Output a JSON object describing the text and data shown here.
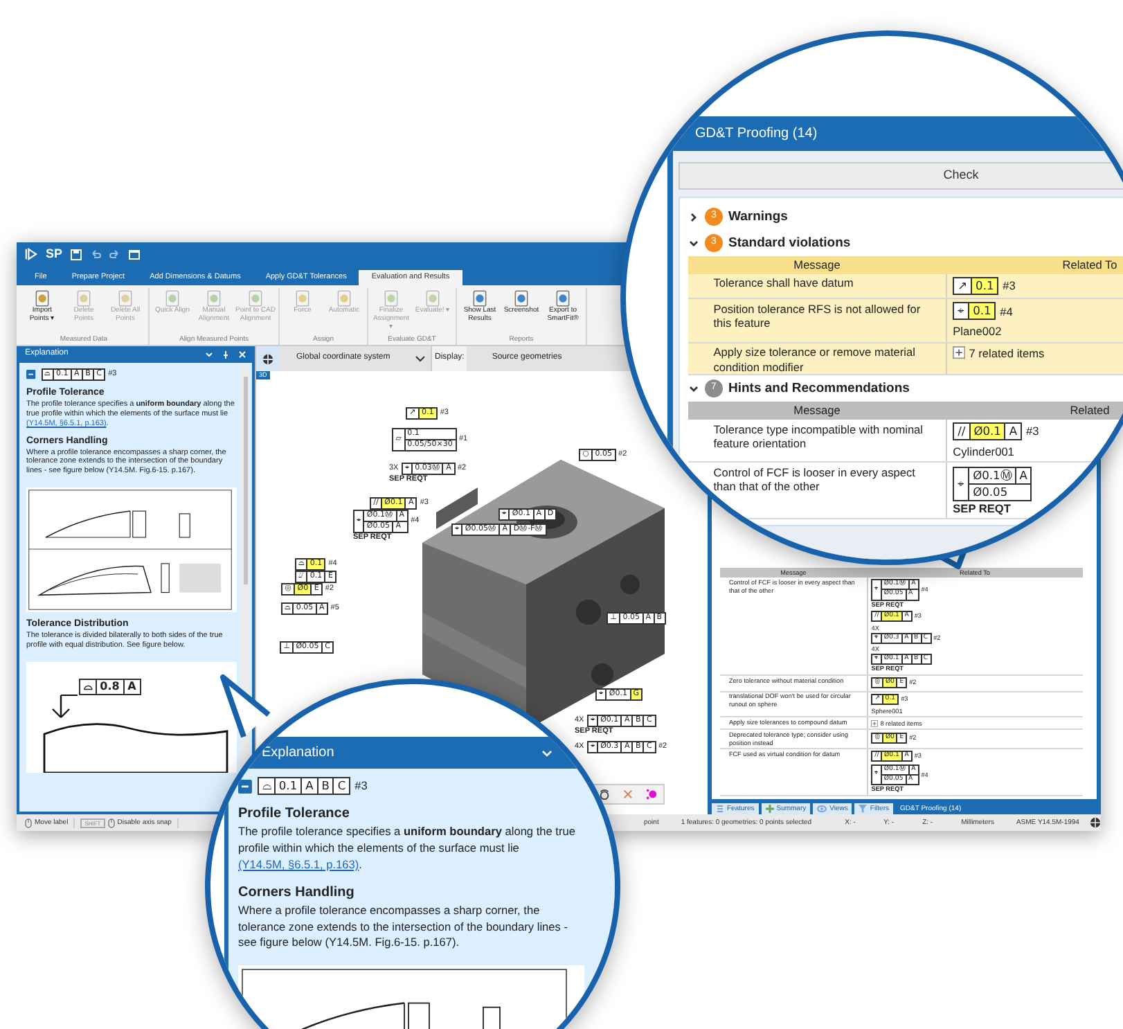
{
  "app": {
    "logo": "SP",
    "ribbon_tabs": [
      {
        "label": "File",
        "selected": false
      },
      {
        "label": "Prepare Project",
        "selected": false
      },
      {
        "label": "Add Dimensions & Datums",
        "selected": false
      },
      {
        "label": "Apply GD&T Tolerances",
        "selected": false
      },
      {
        "label": "Evaluation and Results",
        "selected": true
      }
    ],
    "ribbon_groups": [
      {
        "label": "Measured Data",
        "buttons": [
          {
            "label": "Import Points ▾",
            "disabled": false
          },
          {
            "label": "Delete Points",
            "disabled": true
          },
          {
            "label": "Delete All Points",
            "disabled": true
          }
        ]
      },
      {
        "label": "Align Measured Points",
        "buttons": [
          {
            "label": "Quick Align",
            "disabled": true
          },
          {
            "label": "Manual Alignment",
            "disabled": true
          },
          {
            "label": "Point to CAD Alignment",
            "disabled": true
          }
        ]
      },
      {
        "label": "Assign",
        "buttons": [
          {
            "label": "Force",
            "disabled": true
          },
          {
            "label": "Automatic",
            "disabled": true
          }
        ]
      },
      {
        "label": "Evaluate GD&T",
        "buttons": [
          {
            "label": "Finalize Assignment ▾",
            "disabled": true
          },
          {
            "label": "Evaluate! ▾",
            "disabled": true
          }
        ]
      },
      {
        "label": "Reports",
        "buttons": [
          {
            "label": "Show Last Results",
            "disabled": false
          },
          {
            "label": "Screenshot",
            "disabled": false
          },
          {
            "label": "Export to SmartFit®",
            "disabled": false
          }
        ]
      }
    ],
    "explanation": {
      "title": "Explanation",
      "fcf": {
        "kind": "fcf",
        "cells": [
          {
            "text": "⌓",
            "highlighted": false
          },
          {
            "text": "0.1",
            "highlighted": false
          },
          {
            "text": "A",
            "highlighted": false
          },
          {
            "text": "B",
            "highlighted": false
          },
          {
            "text": "C",
            "highlighted": false
          }
        ],
        "tag": "#3"
      },
      "sections": [
        {
          "heading": "Profile Tolerance",
          "text": "The profile tolerance specifies a **uniform boundary** along the true profile within which the elements of the surface must lie",
          "link": "(Y14.5M, §6.5.1, p.163)",
          "link_suffix": "."
        },
        {
          "heading": "Corners Handling",
          "text": "Where a profile tolerance encompasses a sharp corner, the tolerance zone extends to the intersection of the boundary lines - see figure below (Y14.5M. Fig.6-15. p.167)."
        },
        {
          "heading": "Tolerance Distribution",
          "text": "The tolerance is divided bilaterally to both sides of the true profile with equal distribution. See figure below.",
          "figure": {
            "kind": "profile_diagram",
            "fcf": {
              "kind": "fcf",
              "cells": [
                {
                  "text": "⌓",
                  "highlighted": false
                },
                {
                  "text": "0.8",
                  "highlighted": false
                },
                {
                  "text": "A",
                  "highlighted": false
                }
              ]
            }
          }
        }
      ]
    },
    "viewport": {
      "coordinate_system": "Global coordinate system",
      "display_label": "Display:",
      "display_value": "Source geometries",
      "view_tab": "3D",
      "annotations": [
        {
          "kind": "fcf",
          "cells": [
            {
              "text": "↗",
              "highlighted": false
            },
            {
              "text": "0.1",
              "highlighted": true
            }
          ],
          "tag": "#3"
        },
        {
          "kind": "composite",
          "symbol": {
            "text": "▱",
            "highlighted": false
          },
          "rows": [
            {
              "cells": [
                {
                  "text": "0.1",
                  "highlighted": false
                }
              ]
            },
            {
              "cells": [
                {
                  "text": "0.05/50×30",
                  "highlighted": false
                }
              ]
            }
          ],
          "tag": "#1"
        },
        {
          "kind": "fcf",
          "cells": [
            {
              "text": "○",
              "highlighted": false
            },
            {
              "text": "0.05",
              "highlighted": false
            }
          ],
          "tag": "#2"
        },
        {
          "kind": "fcf",
          "prefix": "3X",
          "cells": [
            {
              "text": "⌖",
              "highlighted": false
            },
            {
              "text": "0.03Ⓜ",
              "highlighted": false
            },
            {
              "text": "A",
              "highlighted": false
            }
          ],
          "tag": "#2",
          "note": "SEP REQT"
        },
        {
          "kind": "fcf",
          "cells": [
            {
              "text": "//",
              "highlighted": false
            },
            {
              "text": "Ø0.1",
              "highlighted": true
            },
            {
              "text": "A",
              "highlighted": false
            }
          ],
          "tag": "#3"
        },
        {
          "kind": "composite",
          "symbol": {
            "text": "⌖",
            "highlighted": false
          },
          "rows": [
            {
              "cells": [
                {
                  "text": "Ø0.1Ⓜ",
                  "highlighted": false
                },
                {
                  "text": "A",
                  "highlighted": false
                }
              ]
            },
            {
              "cells": [
                {
                  "text": "Ø0.05",
                  "highlighted": false
                },
                {
                  "text": "A",
                  "highlighted": false
                }
              ]
            }
          ],
          "tag": "#4",
          "note": "SEP REQT"
        },
        {
          "kind": "fcf",
          "cells": [
            {
              "text": "⌖",
              "highlighted": false
            },
            {
              "text": "Ø0.1",
              "highlighted": false
            },
            {
              "text": "A",
              "highlighted": false
            },
            {
              "text": "D",
              "highlighted": false
            }
          ]
        },
        {
          "kind": "fcf",
          "cells": [
            {
              "text": "⌖",
              "highlighted": false
            },
            {
              "text": "Ø0.05Ⓜ",
              "highlighted": false
            },
            {
              "text": "A",
              "highlighted": false
            },
            {
              "text": "DⓂ-FⓂ",
              "highlighted": false
            }
          ]
        },
        {
          "kind": "fcf",
          "cells": [
            {
              "text": "⌓",
              "highlighted": false
            },
            {
              "text": "0.1",
              "highlighted": true
            }
          ],
          "tag": "#4"
        },
        {
          "kind": "fcf",
          "cells": [
            {
              "text": "⌰",
              "highlighted": false
            },
            {
              "text": "0.1",
              "highlighted": false
            },
            {
              "text": "E",
              "highlighted": false
            }
          ]
        },
        {
          "kind": "fcf",
          "cells": [
            {
              "text": "◎",
              "highlighted": false
            },
            {
              "text": "Ø0",
              "highlighted": true
            },
            {
              "text": "E",
              "highlighted": false
            }
          ],
          "tag": "#2"
        },
        {
          "kind": "fcf",
          "cells": [
            {
              "text": "⌓",
              "highlighted": false
            },
            {
              "text": "0.05",
              "highlighted": false
            },
            {
              "text": "A",
              "highlighted": false
            }
          ],
          "tag": "#5"
        },
        {
          "kind": "fcf",
          "cells": [
            {
              "text": "⊥",
              "highlighted": false
            },
            {
              "text": "Ø0.05",
              "highlighted": false
            },
            {
              "text": "C",
              "highlighted": false
            }
          ]
        },
        {
          "kind": "fcf",
          "cells": [
            {
              "text": "⊥",
              "highlighted": false
            },
            {
              "text": "0.05",
              "highlighted": false
            },
            {
              "text": "A",
              "highlighted": false
            },
            {
              "text": "B",
              "highlighted": false
            }
          ]
        },
        {
          "kind": "fcf",
          "cells": [
            {
              "text": "⌖",
              "highlighted": false
            },
            {
              "text": "Ø0.1",
              "highlighted": false
            },
            {
              "text": "G",
              "highlighted": true
            }
          ]
        },
        {
          "kind": "fcf",
          "prefix": "4X",
          "cells": [
            {
              "text": "⌖",
              "highlighted": false
            },
            {
              "text": "Ø0.1",
              "highlighted": false
            },
            {
              "text": "A",
              "highlighted": false
            },
            {
              "text": "B",
              "highlighted": false
            },
            {
              "text": "C",
              "highlighted": false
            }
          ],
          "note": "SEP REQT"
        },
        {
          "kind": "fcf",
          "prefix": "4X",
          "cells": [
            {
              "text": "⌖",
              "highlighted": false
            },
            {
              "text": "Ø0.3",
              "highlighted": false
            },
            {
              "text": "A",
              "highlighted": false
            },
            {
              "text": "B",
              "highlighted": false
            },
            {
              "text": "C",
              "highlighted": false
            }
          ],
          "tag": "#2"
        }
      ]
    },
    "proofing": {
      "columns": [
        "Message",
        "Related To"
      ],
      "rows": [
        {
          "message": "Control of FCF is looser in every aspect than that of the other",
          "related": [
            {
              "kind": "composite",
              "symbol": {
                "text": "⌖",
                "highlighted": false
              },
              "rows": [
                {
                  "cells": [
                    {
                      "text": "Ø0.1Ⓜ",
                      "highlighted": false
                    },
                    {
                      "text": "A",
                      "highlighted": false
                    }
                  ]
                },
                {
                  "cells": [
                    {
                      "text": "Ø0.05",
                      "highlighted": false
                    },
                    {
                      "text": "A",
                      "highlighted": false
                    }
                  ]
                }
              ],
              "tag": "#4",
              "note": "SEP REQT"
            },
            {
              "kind": "fcf",
              "cells": [
                {
                  "text": "//",
                  "highlighted": false
                },
                {
                  "text": "Ø0.1",
                  "highlighted": true
                },
                {
                  "text": "A",
                  "highlighted": false
                }
              ],
              "tag": "#3"
            },
            {
              "kind": "fcf",
              "prefix": "4X",
              "cells": [
                {
                  "text": "⌖",
                  "highlighted": false
                },
                {
                  "text": "Ø0.3",
                  "highlighted": false
                },
                {
                  "text": "A",
                  "highlighted": false
                },
                {
                  "text": "B",
                  "highlighted": false
                },
                {
                  "text": "C",
                  "highlighted": false
                }
              ],
              "tag": "#2"
            },
            {
              "kind": "fcf",
              "prefix": "4X",
              "cells": [
                {
                  "text": "⌖",
                  "highlighted": false
                },
                {
                  "text": "Ø0.1",
                  "highlighted": false
                },
                {
                  "text": "A",
                  "highlighted": false
                },
                {
                  "text": "B",
                  "highlighted": false
                },
                {
                  "text": "C",
                  "highlighted": false
                }
              ],
              "note": "SEP REQT"
            }
          ]
        },
        {
          "message": "Zero tolerance without material condition",
          "related": [
            {
              "kind": "fcf",
              "cells": [
                {
                  "text": "◎",
                  "highlighted": false
                },
                {
                  "text": "Ø0",
                  "highlighted": true
                },
                {
                  "text": "E",
                  "highlighted": false
                }
              ],
              "tag": "#2"
            }
          ]
        },
        {
          "message": "translational DOF won't be used for circular runout on sphere",
          "related": [
            {
              "kind": "fcf",
              "cells": [
                {
                  "text": "↗",
                  "highlighted": false
                },
                {
                  "text": "0.1",
                  "highlighted": true
                }
              ],
              "tag": "#3"
            },
            {
              "kind": "feature",
              "text": "Sphere001"
            }
          ]
        },
        {
          "message": "Apply size tolerances to compound datum",
          "related": [
            {
              "kind": "expander",
              "text": "8 related items"
            }
          ]
        },
        {
          "message": "Deprecated tolerance type; consider using position instead",
          "related": [
            {
              "kind": "fcf",
              "cells": [
                {
                  "text": "◎",
                  "highlighted": false
                },
                {
                  "text": "Ø0",
                  "highlighted": true
                },
                {
                  "text": "E",
                  "highlighted": false
                }
              ],
              "tag": "#2"
            }
          ]
        },
        {
          "message": "FCF used as virtual condition for datum",
          "related": [
            {
              "kind": "fcf",
              "cells": [
                {
                  "text": "//",
                  "highlighted": false
                },
                {
                  "text": "Ø0.1",
                  "highlighted": true
                },
                {
                  "text": "A",
                  "highlighted": false
                }
              ],
              "tag": "#3"
            },
            {
              "kind": "composite",
              "symbol": {
                "text": "⌖",
                "highlighted": false
              },
              "rows": [
                {
                  "cells": [
                    {
                      "text": "Ø0.1Ⓜ",
                      "highlighted": false
                    },
                    {
                      "text": "A",
                      "highlighted": false
                    }
                  ]
                },
                {
                  "cells": [
                    {
                      "text": "Ø0.05",
                      "highlighted": false
                    },
                    {
                      "text": "A",
                      "highlighted": false
                    }
                  ]
                }
              ],
              "tag": "#4",
              "note": "SEP REQT"
            }
          ]
        }
      ]
    },
    "bottom_tabs": [
      {
        "label": "Features",
        "selected": false
      },
      {
        "label": "Summary",
        "selected": false
      },
      {
        "label": "Views",
        "selected": false
      },
      {
        "label": "Filters",
        "selected": false
      },
      {
        "label": "GD&T Proofing (14)",
        "selected": true
      }
    ],
    "status_bar": {
      "hints": [
        {
          "kind": "mouse",
          "text": "Move label"
        },
        {
          "kind": "key_mouse",
          "key": "SHIFT",
          "text": "Disable axis snap"
        }
      ],
      "hint_tail": "point",
      "selection": "1 features: 0 geometries: 0 points selected",
      "coords": [
        "X: -",
        "Y: -",
        "Z: -"
      ],
      "units": "Millimeters",
      "standard": "ASME Y14.5M-1994"
    }
  },
  "proofing_magnifier": {
    "title": "GD&T Proofing (14)",
    "check_button": "Check",
    "sections": [
      {
        "title": "Warnings",
        "count": "3",
        "kind": "warning",
        "expanded": false
      },
      {
        "title": "Standard violations",
        "count": "3",
        "kind": "warning",
        "expanded": true,
        "columns": [
          "Message",
          "Related To"
        ],
        "rows": [
          {
            "message": "Tolerance shall have datum",
            "related": [
              {
                "kind": "fcf",
                "cells": [
                  {
                    "text": "↗",
                    "highlighted": false
                  },
                  {
                    "text": "0.1",
                    "highlighted": true
                  }
                ],
                "tag": "#3"
              }
            ]
          },
          {
            "message": "Position tolerance RFS is not allowed for this feature",
            "related": [
              {
                "kind": "fcf",
                "cells": [
                  {
                    "text": "⌖",
                    "highlighted": false
                  },
                  {
                    "text": "0.1",
                    "highlighted": true
                  }
                ],
                "tag": "#4"
              },
              {
                "kind": "feature",
                "text": "Plane002"
              }
            ]
          },
          {
            "message": "Apply size tolerance or remove material condition modifier",
            "related": [
              {
                "kind": "expander",
                "text": "7 related items"
              }
            ]
          }
        ]
      },
      {
        "title": "Hints and Recommendations",
        "count": "7",
        "kind": "hint",
        "expanded": true,
        "columns": [
          "Message",
          "Related"
        ],
        "rows": [
          {
            "message": "Tolerance type incompatible with nominal feature orientation",
            "related": [
              {
                "kind": "fcf",
                "cells": [
                  {
                    "text": "//",
                    "highlighted": false
                  },
                  {
                    "text": "Ø0.1",
                    "highlighted": true
                  },
                  {
                    "text": "A",
                    "highlighted": false
                  }
                ],
                "tag": "#3"
              },
              {
                "kind": "feature",
                "text": "Cylinder001"
              }
            ]
          },
          {
            "message": "Control of FCF is looser in every aspect than that of the other",
            "related": [
              {
                "kind": "composite",
                "symbol": {
                  "text": "⌖",
                  "highlighted": false
                },
                "rows": [
                  {
                    "cells": [
                      {
                        "text": "Ø0.1Ⓜ",
                        "highlighted": false
                      },
                      {
                        "text": "A",
                        "highlighted": false
                      }
                    ]
                  },
                  {
                    "cells": [
                      {
                        "text": "Ø0.05",
                        "highlighted": false
                      }
                    ]
                  }
                ],
                "note": "SEP REQT"
              }
            ]
          }
        ]
      }
    ]
  },
  "explanation_magnifier": {
    "title": "Explanation",
    "fcf": {
      "kind": "fcf",
      "cells": [
        {
          "text": "⌓",
          "highlighted": false
        },
        {
          "text": "0.1",
          "highlighted": false
        },
        {
          "text": "A",
          "highlighted": false
        },
        {
          "text": "B",
          "highlighted": false
        },
        {
          "text": "C",
          "highlighted": false
        }
      ],
      "tag": "#3"
    },
    "sections": [
      {
        "heading": "Profile Tolerance",
        "text": "The profile tolerance specifies a **uniform boundary** along the true profile within which the elements of the surface must lie",
        "link": "(Y14.5M, §6.5.1, p.163)",
        "link_suffix": "."
      },
      {
        "heading": "Corners Handling",
        "text": "Where a profile tolerance encompasses a sharp corner, the tolerance zone extends to the intersection of the boundary lines - see figure below (Y14.5M. Fig.6-15. p.167)."
      }
    ]
  }
}
